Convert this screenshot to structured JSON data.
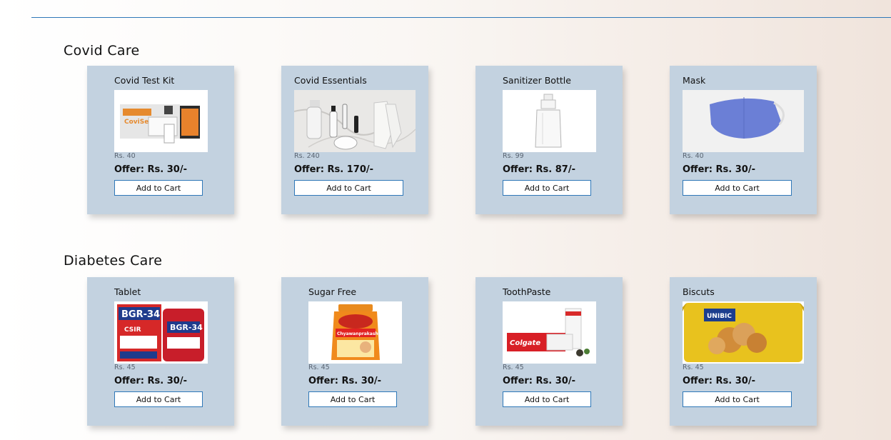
{
  "sections": [
    {
      "title": "Covid Care",
      "products": [
        {
          "name": "Covid Test Kit",
          "price": "Rs. 40",
          "offer": "Offer: Rs. 30/-",
          "button": "Add to Cart",
          "icon": "test-kit-icon"
        },
        {
          "name": "Covid Essentials",
          "price": "Rs. 240",
          "offer": "Offer: Rs. 170/-",
          "button": "Add to Cart",
          "icon": "essentials-icon"
        },
        {
          "name": "Sanitizer Bottle",
          "price": "Rs. 99",
          "offer": "Offer: Rs. 87/-",
          "button": "Add to Cart",
          "icon": "sanitizer-icon"
        },
        {
          "name": "Mask",
          "price": "Rs. 40",
          "offer": "Offer: Rs. 30/-",
          "button": "Add to Cart",
          "icon": "mask-icon"
        }
      ]
    },
    {
      "title": "Diabetes Care",
      "products": [
        {
          "name": "Tablet",
          "price": "Rs. 45",
          "offer": "Offer: Rs. 30/-",
          "button": "Add to Cart",
          "icon": "tablet-icon"
        },
        {
          "name": "Sugar Free",
          "price": "Rs. 45",
          "offer": "Offer: Rs. 30/-",
          "button": "Add to Cart",
          "icon": "sugar-free-icon"
        },
        {
          "name": "ToothPaste",
          "price": "Rs. 45",
          "offer": "Offer: Rs. 30/-",
          "button": "Add to Cart",
          "icon": "toothpaste-icon"
        },
        {
          "name": "Biscuts",
          "price": "Rs. 45",
          "offer": "Offer: Rs. 30/-",
          "button": "Add to Cart",
          "icon": "biscuits-icon"
        }
      ]
    }
  ],
  "image_text": {
    "test_kit": "CoviSelf",
    "tablet_brand": "BGR-34",
    "tablet_sub": "CSIR",
    "sugar_free": "Chyawanprakash",
    "toothpaste": "Colgate",
    "biscuits": "UNIBIC"
  },
  "colors": {
    "card_bg": "#c3d2e0",
    "accent_border": "#2f78b8",
    "button_bg": "#ffffff"
  }
}
